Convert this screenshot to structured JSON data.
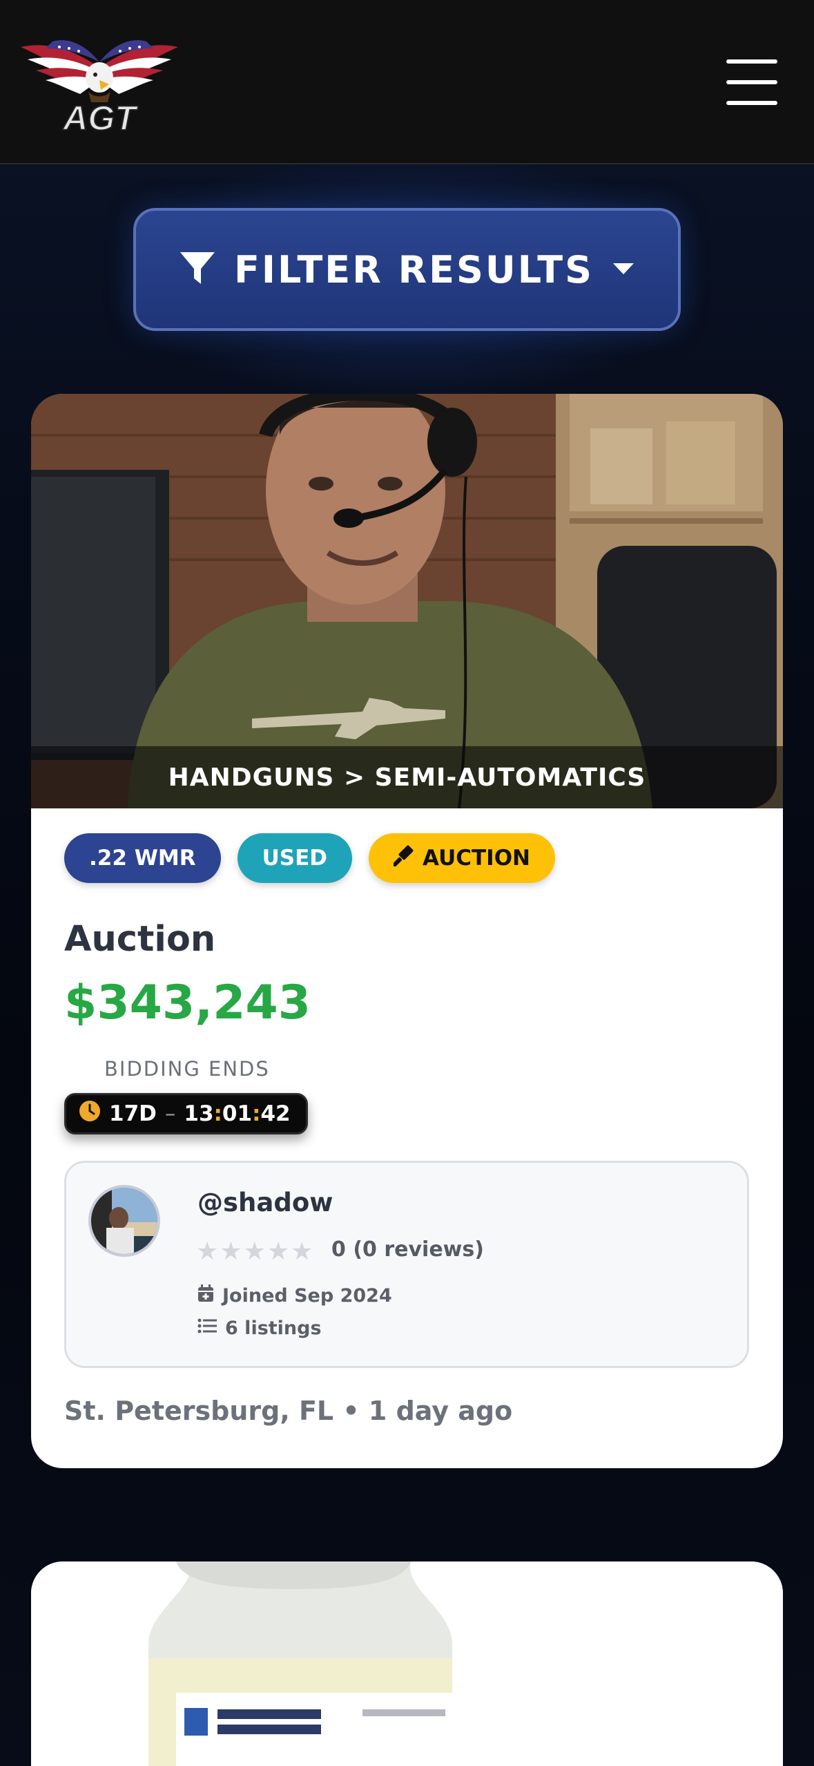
{
  "header": {
    "logo_text": "AGT",
    "menu_icon": "hamburger-menu-icon"
  },
  "filter": {
    "label": "FILTER RESULTS",
    "icon": "filter-funnel-icon",
    "chevron_icon": "caret-down-icon"
  },
  "listings": [
    {
      "category": "HANDGUNS > SEMI-AUTOMATICS",
      "badges": {
        "caliber": ".22 WMR",
        "condition": "USED",
        "type": "AUCTION"
      },
      "listing_type": "Auction",
      "price": "$343,243",
      "bidding_label": "BIDDING ENDS",
      "timer": {
        "days": "17D",
        "separator": "–",
        "hours": "13",
        "minutes": "01",
        "seconds": "42"
      },
      "seller": {
        "username": "@shadow",
        "rating_text": "0 (0 reviews)",
        "rating_stars": 0,
        "joined": "Joined Sep 2024",
        "listings_count": "6 listings"
      },
      "location": "St. Petersburg, FL",
      "posted": "1 day ago"
    }
  ],
  "colors": {
    "accent_blue": "#2c4491",
    "price_green": "#28a745",
    "auction_yellow": "#ffc107",
    "condition_teal": "#1fa3b8"
  }
}
